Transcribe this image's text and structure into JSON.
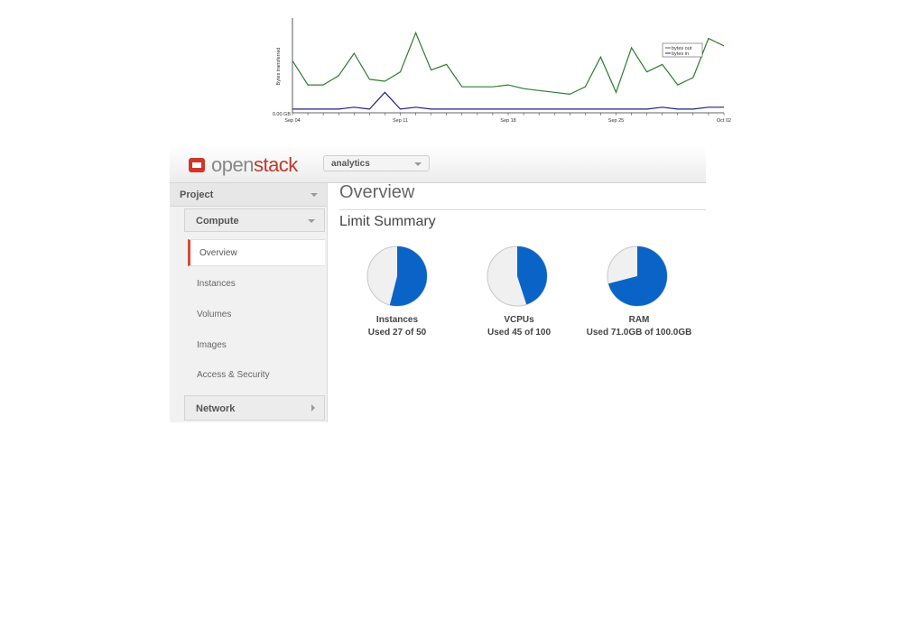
{
  "traffic_chart": {
    "ylabel": "Bytes transferred",
    "y_zero_label": "0.00 GB",
    "x_labels": [
      "Sep 04",
      "Sep 11",
      "Sep 18",
      "Sep 25",
      "Oct 02"
    ],
    "legend": [
      "bytes out",
      "bytes in"
    ],
    "colors": {
      "bytes_out": "#2e7d32",
      "bytes_in": "#1a237e"
    }
  },
  "chart_data": {
    "type": "line",
    "x": [
      0,
      1,
      2,
      3,
      4,
      5,
      6,
      7,
      8,
      9,
      10,
      11,
      12,
      13,
      14,
      15,
      16,
      17,
      18,
      19,
      20,
      21,
      22,
      23,
      24,
      25,
      26,
      27,
      28
    ],
    "series": [
      {
        "name": "bytes out",
        "values": [
          28,
          15,
          15,
          20,
          32,
          18,
          17,
          22,
          43,
          23,
          26,
          14,
          14,
          14,
          15,
          13,
          12,
          11,
          10,
          14,
          30,
          11,
          35,
          22,
          26,
          15,
          19,
          40,
          36
        ]
      },
      {
        "name": "bytes in",
        "values": [
          2,
          2,
          2,
          2,
          3,
          2,
          11,
          2,
          3,
          2,
          2,
          2,
          2,
          2,
          2,
          2,
          2,
          2,
          2,
          2,
          2,
          2,
          2,
          2,
          3,
          2,
          2,
          3,
          3
        ]
      }
    ],
    "xlabel": "",
    "ylabel": "Bytes transferred",
    "ylim": [
      0,
      50
    ],
    "legend_position": "top-right"
  },
  "header": {
    "logo_open": "open",
    "logo_stack": "stack",
    "project_selected": "analytics"
  },
  "sidebar": {
    "project": "Project",
    "compute": "Compute",
    "items": [
      "Overview",
      "Instances",
      "Volumes",
      "Images",
      "Access & Security"
    ],
    "network": "Network"
  },
  "main": {
    "title": "Overview",
    "limit_title": "Limit Summary",
    "limits": [
      {
        "name": "Instances",
        "used_text": "Used 27 of 50",
        "used": 27,
        "total": 50
      },
      {
        "name": "VCPUs",
        "used_text": "Used 45 of 100",
        "used": 45,
        "total": 100
      },
      {
        "name": "RAM",
        "used_text": "Used 71.0GB of 100.0GB",
        "used": 71,
        "total": 100
      }
    ],
    "colors": {
      "used": "#0a64c8",
      "free": "#f0f0f0",
      "border": "#c8c8c8"
    }
  }
}
